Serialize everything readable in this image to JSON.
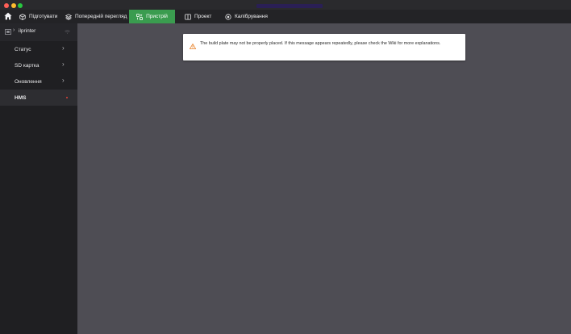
{
  "window": {
    "controls": [
      "close",
      "minimize",
      "zoom"
    ]
  },
  "tabs": [
    {
      "label": "Підготувати",
      "icon": "cube-icon"
    },
    {
      "label": "Попередній перегляд",
      "icon": "layers-icon"
    },
    {
      "label": "Пристрій",
      "icon": "device-icon",
      "active": true
    },
    {
      "label": "Проект",
      "icon": "project-icon"
    },
    {
      "label": "Калібрування",
      "icon": "calibration-icon"
    }
  ],
  "sidebar": {
    "printer_name": "ilprinter",
    "items": [
      {
        "label": "Статус",
        "chevron": true
      },
      {
        "label": "SD картка",
        "chevron": true
      },
      {
        "label": "Оновлення",
        "chevron": true
      },
      {
        "label": "HMS",
        "active": true,
        "badge": "red-dot"
      }
    ]
  },
  "notice": {
    "icon": "warning-icon",
    "message": "The build plate may not be properly placed. If this message appears repeatedly, please check the Wiki for more explanations."
  },
  "colors": {
    "accent": "#3a9c4f",
    "sidebar_bg": "#1f1f22",
    "main_bg": "#4e4d54",
    "warning": "#e8832c"
  }
}
